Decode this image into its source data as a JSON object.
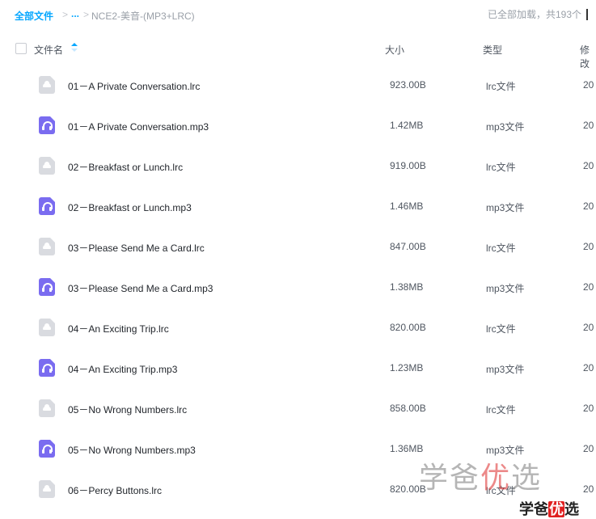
{
  "breadcrumb": {
    "root": "全部文件",
    "sep1": ">",
    "ellipsis": "...",
    "sep2": ">",
    "current": "NCE2-美音-(MP3+LRC)"
  },
  "status": {
    "loaded_text": "已全部加载，共193个"
  },
  "columns": {
    "name": "文件名",
    "size": "大小",
    "type": "类型",
    "modified": "修改"
  },
  "files": [
    {
      "name": "01－A Private Conversation.lrc",
      "size": "923.00B",
      "type": "lrc文件",
      "date": "20",
      "icon": "lrc-file-icon"
    },
    {
      "name": "01－A Private Conversation.mp3",
      "size": "1.42MB",
      "type": "mp3文件",
      "date": "20",
      "icon": "audio-file-icon"
    },
    {
      "name": "02－Breakfast or Lunch.lrc",
      "size": "919.00B",
      "type": "lrc文件",
      "date": "20",
      "icon": "lrc-file-icon"
    },
    {
      "name": "02－Breakfast or Lunch.mp3",
      "size": "1.46MB",
      "type": "mp3文件",
      "date": "20",
      "icon": "audio-file-icon"
    },
    {
      "name": "03－Please Send Me a Card.lrc",
      "size": "847.00B",
      "type": "lrc文件",
      "date": "20",
      "icon": "lrc-file-icon"
    },
    {
      "name": "03－Please Send Me a Card.mp3",
      "size": "1.38MB",
      "type": "mp3文件",
      "date": "20",
      "icon": "audio-file-icon"
    },
    {
      "name": "04－An Exciting Trip.lrc",
      "size": "820.00B",
      "type": "lrc文件",
      "date": "20",
      "icon": "lrc-file-icon"
    },
    {
      "name": "04－An Exciting Trip.mp3",
      "size": "1.23MB",
      "type": "mp3文件",
      "date": "20",
      "icon": "audio-file-icon"
    },
    {
      "name": "05－No Wrong Numbers.lrc",
      "size": "858.00B",
      "type": "lrc文件",
      "date": "20",
      "icon": "lrc-file-icon"
    },
    {
      "name": "05－No Wrong Numbers.mp3",
      "size": "1.36MB",
      "type": "mp3文件",
      "date": "20",
      "icon": "audio-file-icon"
    },
    {
      "name": "06－Percy Buttons.lrc",
      "size": "820.00B",
      "type": "lrc文件",
      "date": "20",
      "icon": "lrc-file-icon"
    }
  ],
  "watermark": {
    "part1": "学爸",
    "highlight": "优",
    "part2": "选"
  },
  "colors": {
    "accent": "#06a7ff",
    "audio_icon": "#7a6cf0",
    "doc_icon": "#d9dbe0"
  }
}
